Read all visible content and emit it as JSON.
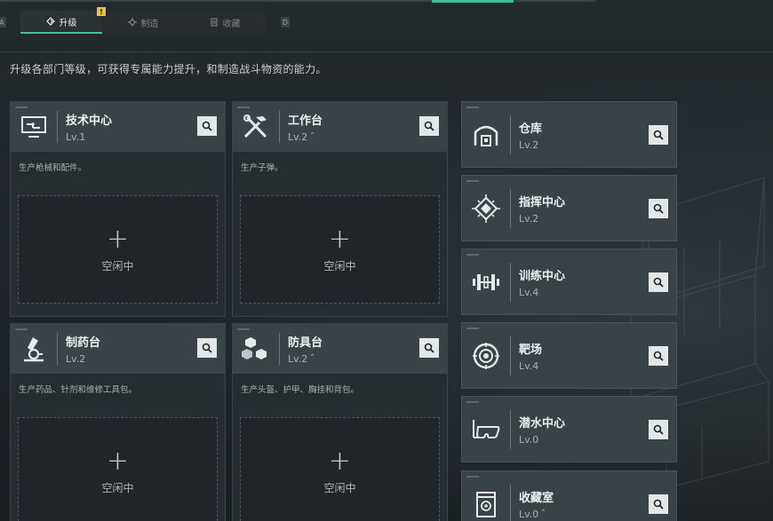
{
  "tabs": {
    "left_key": "A",
    "right_key": "D",
    "items": [
      {
        "label": "升级",
        "active": true,
        "alert": "!"
      },
      {
        "label": "制造",
        "active": false
      },
      {
        "label": "收藏",
        "active": false
      }
    ]
  },
  "description": "升级各部门等级，可获得专属能力提升，和制造战斗物资的能力。",
  "facilities": [
    {
      "name": "技术中心",
      "level": "Lv.1",
      "upgradable": false,
      "desc": "生产枪械和配件。",
      "slot_status": "空闲中",
      "icon": "computer-icon"
    },
    {
      "name": "工作台",
      "level": "Lv.2",
      "upgradable": true,
      "desc": "生产子弹。",
      "slot_status": "空闲中",
      "icon": "tools-icon"
    },
    {
      "name": "制药台",
      "level": "Lv.2",
      "upgradable": false,
      "desc": "生产药品、针剂和维修工具包。",
      "slot_status": "空闲中",
      "icon": "microscope-icon"
    },
    {
      "name": "防具台",
      "level": "Lv.2",
      "upgradable": true,
      "desc": "生产头盔、护甲、胸挂和背包。",
      "slot_status": "空闲中",
      "icon": "cubes-icon"
    }
  ],
  "side_facilities": [
    {
      "name": "仓库",
      "level": "Lv.2",
      "upgradable": false,
      "icon": "warehouse-icon"
    },
    {
      "name": "指挥中心",
      "level": "Lv.2",
      "upgradable": false,
      "icon": "chip-icon"
    },
    {
      "name": "训练中心",
      "level": "Lv.4",
      "upgradable": false,
      "icon": "dumbbell-icon"
    },
    {
      "name": "靶场",
      "level": "Lv.4",
      "upgradable": false,
      "icon": "target-icon"
    },
    {
      "name": "潜水中心",
      "level": "Lv.0",
      "upgradable": false,
      "icon": "diving-mask-icon"
    },
    {
      "name": "收藏室",
      "level": "Lv.0",
      "upgradable": true,
      "icon": "collection-icon"
    }
  ],
  "colors": {
    "accent": "#3fbf9a",
    "alert": "#e6c24a"
  }
}
